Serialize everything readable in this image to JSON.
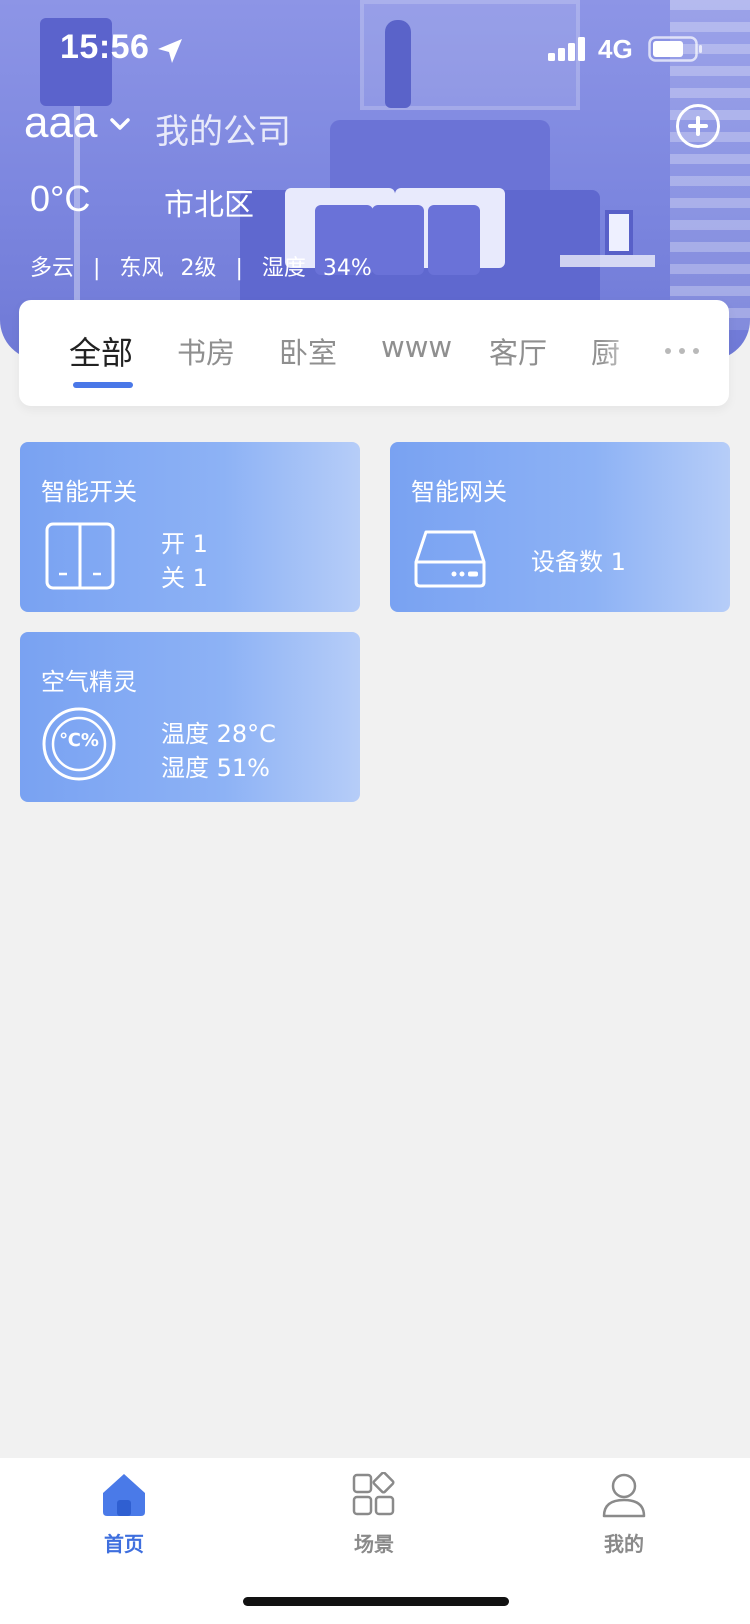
{
  "status_bar": {
    "time": "15:56",
    "network": "4G",
    "location_icon": "location-arrow-icon",
    "signal_icon": "signal-bars-icon",
    "battery_icon": "battery-icon"
  },
  "header": {
    "user": "aaa",
    "company": "我的公司",
    "temperature": "0°C",
    "district": "市北区",
    "weather": {
      "condition": "多云",
      "wind": "东风",
      "wind_level": "2级",
      "humidity_label": "湿度",
      "humidity_value": "34%"
    },
    "weather_sep": "|"
  },
  "tabs": {
    "items": [
      "全部",
      "书房",
      "卧室",
      "www",
      "客厅",
      "厨"
    ],
    "active_index": 0
  },
  "devices": [
    {
      "title": "智能开关",
      "icon": "switch-panel-icon",
      "lines": [
        "开 1",
        "关 1"
      ]
    },
    {
      "title": "智能网关",
      "icon": "gateway-icon",
      "lines": [
        "设备数 1"
      ]
    },
    {
      "title": "空气精灵",
      "icon": "air-sensor-icon",
      "icon_text": "℃%",
      "lines": [
        "温度 28°C",
        "湿度 51%"
      ]
    }
  ],
  "bottom_nav": {
    "items": [
      {
        "label": "首页",
        "icon": "home-icon",
        "active": true
      },
      {
        "label": "场景",
        "icon": "scene-icon",
        "active": false
      },
      {
        "label": "我的",
        "icon": "profile-icon",
        "active": false
      }
    ]
  },
  "colors": {
    "accent": "#3f6fde",
    "hero": "#7c86df",
    "card_start": "#79a2f2",
    "card_end": "#b6cdf8",
    "background": "#f1f1f1"
  }
}
